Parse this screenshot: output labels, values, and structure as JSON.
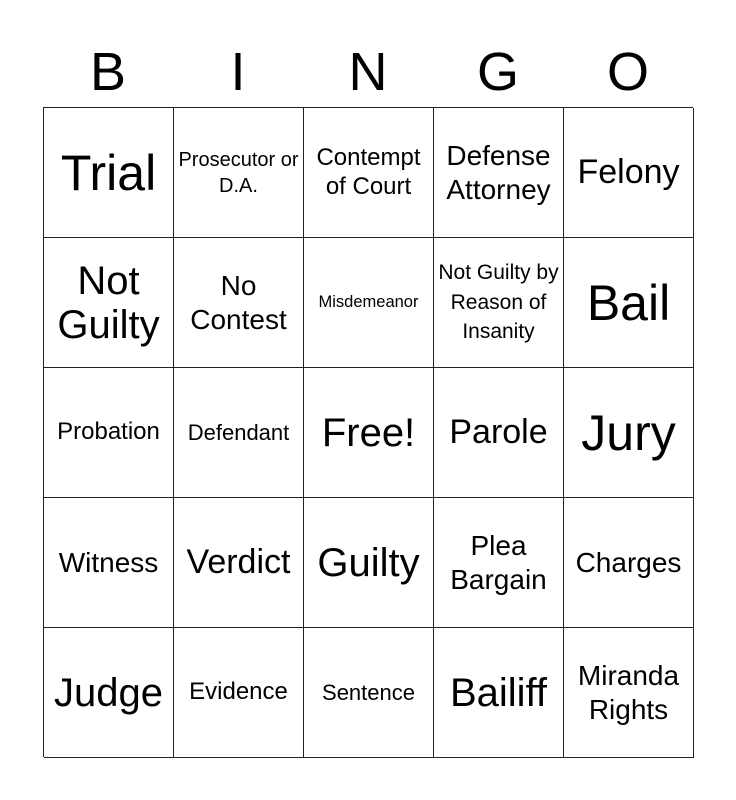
{
  "header": {
    "letters": [
      "B",
      "I",
      "N",
      "G",
      "O"
    ]
  },
  "card": {
    "rows": [
      [
        "Trial",
        "Prosecutor or D.A.",
        "Contempt of Court",
        "Defense Attorney",
        "Felony"
      ],
      [
        "Not Guilty",
        "No Contest",
        "Misdemeanor",
        "Not Guilty by Reason of Insanity",
        "Bail"
      ],
      [
        "Probation",
        "Defendant",
        "Free!",
        "Parole",
        "Jury"
      ],
      [
        "Witness",
        "Verdict",
        "Guilty",
        "Plea Bargain",
        "Charges"
      ],
      [
        "Judge",
        "Evidence",
        "Sentence",
        "Bailiff",
        "Miranda Rights"
      ]
    ],
    "free_space": "Free!"
  }
}
